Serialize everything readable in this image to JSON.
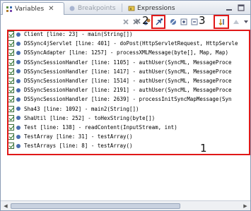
{
  "tabs": [
    {
      "label": "Variables",
      "active": true,
      "icon": "variables-icon"
    },
    {
      "label": "Breakpoints",
      "active": false,
      "faded": true,
      "icon": "breakpoints-icon"
    },
    {
      "label": "Expressions",
      "active": false,
      "icon": "expressions-icon"
    }
  ],
  "tab_close": "✕",
  "toolbar": {
    "icons": [
      "remove-breakpoint-icon",
      "remove-all-breakpoints-icon",
      "show-breakpoints-supported-icon",
      "go-to-file-icon",
      "skip-all-breakpoints-icon",
      "expand-all-icon",
      "collapse-all-icon",
      "link-with-debug-view-icon",
      "add-java-exception-icon",
      "view-menu-icon"
    ]
  },
  "annotations": {
    "one": "1",
    "two": "2",
    "three": "3"
  },
  "breakpoints": [
    {
      "text": "Client [line: 23] - main(String[])"
    },
    {
      "text": "DSSync4jServlet [line: 401] - doPost(HttpServletRequest, HttpServle"
    },
    {
      "text": "DSSyncAdapter [line: 1257] - processXMLMessage(byte[], Map, Map)"
    },
    {
      "text": "DSSyncSessionHandler [line: 1105] - authUser(SyncML, MessageProce"
    },
    {
      "text": "DSSyncSessionHandler [line: 1417] - authUser(SyncML, MessageProce"
    },
    {
      "text": "DSSyncSessionHandler [line: 1514] - authUser(SyncML, MessageProce"
    },
    {
      "text": "DSSyncSessionHandler [line: 2191] - authUser(SyncML, MessageProce"
    },
    {
      "text": "DSSyncSessionHandler [line: 2639] - processInitSyncMapMessage(Syn"
    },
    {
      "text": "Sha43 [line: 1092] - main2(String[])"
    },
    {
      "text": "ShaUtil [line: 252] - toHexString(byte[])"
    },
    {
      "text": "Test [line: 138] - readContent(InputStream, int)"
    },
    {
      "text": "TestArray [line: 31] - testArray()"
    },
    {
      "text": "TestArrays [line: 8] - testArray()"
    }
  ]
}
